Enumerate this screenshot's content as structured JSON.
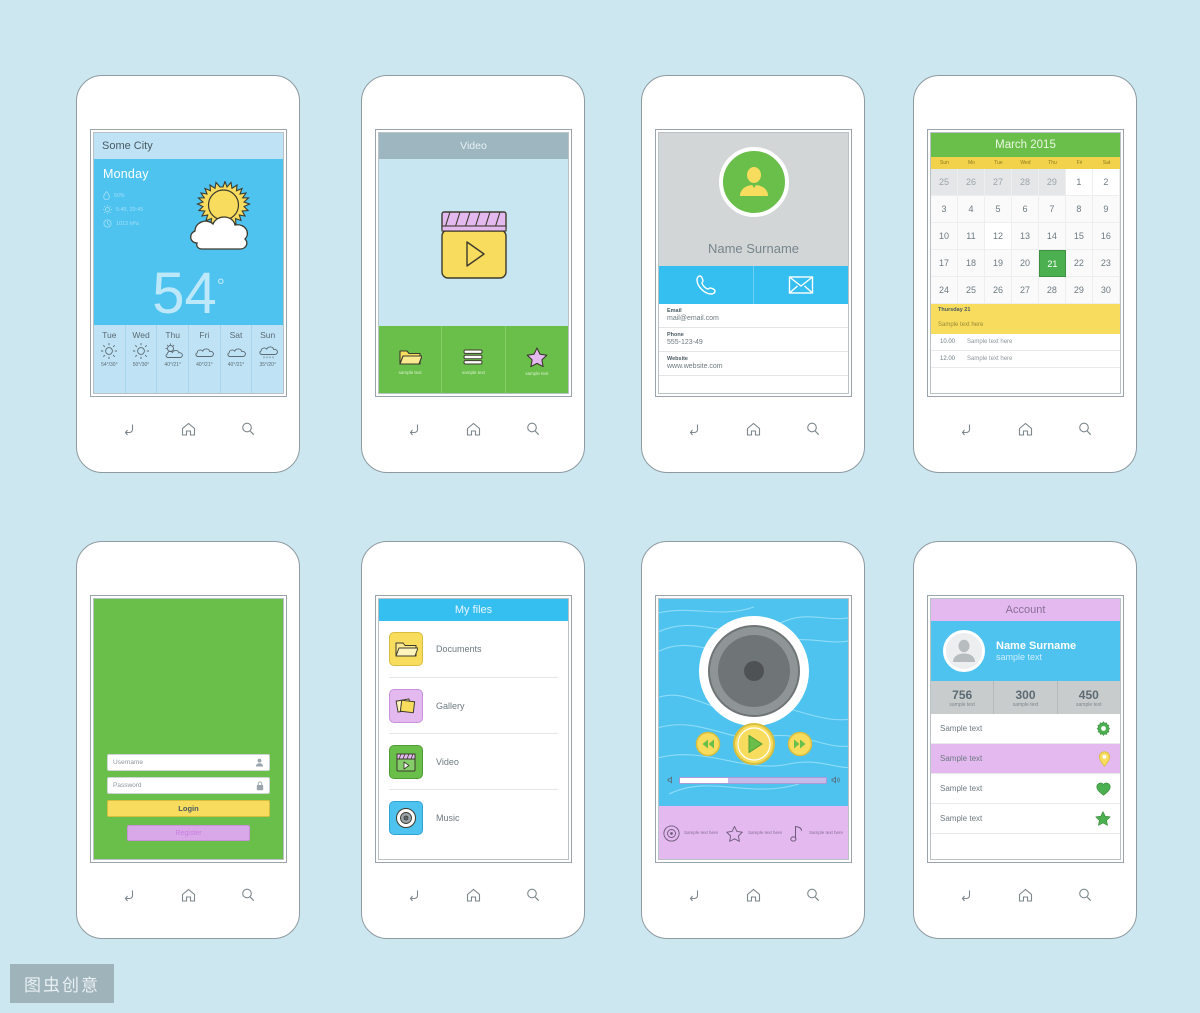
{
  "watermark": "图虫创意",
  "nav": {
    "back": "back-arrow-icon",
    "home": "home-icon",
    "search": "search-icon"
  },
  "colors": {
    "background": "#cde7f0",
    "sky_blue": "#4ec3f0",
    "green": "#6abf4b",
    "yellow": "#f7dc5e",
    "purple": "#e3b9f0",
    "gray": "#d3d6d7"
  },
  "phones": {
    "weather": {
      "city": "Some City",
      "day": "Monday",
      "stats": [
        {
          "icon": "humidity-drop-icon",
          "text": "50%"
        },
        {
          "icon": "sun-times-icon",
          "text": "5:40, 20:45"
        },
        {
          "icon": "wind-clock-icon",
          "text": "1013 hPa"
        }
      ],
      "temperature": "54",
      "degree": "°",
      "forecast": [
        {
          "day": "Tue",
          "icon": "sun-icon",
          "temp": "54°/30°"
        },
        {
          "day": "Wed",
          "icon": "sun-icon",
          "temp": "50°/30°"
        },
        {
          "day": "Thu",
          "icon": "sun-cloud-icon",
          "temp": "40°/21°"
        },
        {
          "day": "Fri",
          "icon": "cloud-icon",
          "temp": "40°/21°"
        },
        {
          "day": "Sat",
          "icon": "cloud-icon",
          "temp": "40°/21°"
        },
        {
          "day": "Sun",
          "icon": "rain-cloud-icon",
          "temp": "35°/20°"
        }
      ]
    },
    "video": {
      "title": "Video",
      "poster_icon": "clapperboard-play-icon",
      "tabs": [
        {
          "icon": "folder-icon",
          "label": "sample text"
        },
        {
          "icon": "list-icon",
          "label": "sample text"
        },
        {
          "icon": "star-icon",
          "label": "sample text"
        }
      ]
    },
    "contact": {
      "avatar_icon": "person-avatar-icon",
      "name": "Name Surname",
      "actions": [
        {
          "icon": "phone-icon",
          "label": "call"
        },
        {
          "icon": "envelope-icon",
          "label": "email"
        }
      ],
      "fields": [
        {
          "label": "Email",
          "value": "mail@email.com"
        },
        {
          "label": "Phone",
          "value": "555-123-49"
        },
        {
          "label": "Website",
          "value": "www.website.com"
        }
      ]
    },
    "calendar": {
      "title": "March 2015",
      "weekdays": [
        "Sun",
        "Mo",
        "Tue",
        "Wed",
        "Thu",
        "Fri",
        "Sat"
      ],
      "days": [
        {
          "n": "25",
          "type": "other"
        },
        {
          "n": "26",
          "type": "other"
        },
        {
          "n": "27",
          "type": "other"
        },
        {
          "n": "28",
          "type": "other"
        },
        {
          "n": "29",
          "type": "other"
        },
        {
          "n": "1",
          "type": "white"
        },
        {
          "n": "2",
          "type": "white"
        },
        {
          "n": "3",
          "type": ""
        },
        {
          "n": "4",
          "type": ""
        },
        {
          "n": "5",
          "type": ""
        },
        {
          "n": "6",
          "type": ""
        },
        {
          "n": "7",
          "type": ""
        },
        {
          "n": "8",
          "type": ""
        },
        {
          "n": "9",
          "type": ""
        },
        {
          "n": "10",
          "type": ""
        },
        {
          "n": "11",
          "type": ""
        },
        {
          "n": "12",
          "type": "white"
        },
        {
          "n": "13",
          "type": ""
        },
        {
          "n": "14",
          "type": ""
        },
        {
          "n": "15",
          "type": ""
        },
        {
          "n": "16",
          "type": ""
        },
        {
          "n": "17",
          "type": ""
        },
        {
          "n": "18",
          "type": ""
        },
        {
          "n": "19",
          "type": ""
        },
        {
          "n": "20",
          "type": ""
        },
        {
          "n": "21",
          "type": "sel"
        },
        {
          "n": "22",
          "type": ""
        },
        {
          "n": "23",
          "type": ""
        },
        {
          "n": "24",
          "type": ""
        },
        {
          "n": "25",
          "type": ""
        },
        {
          "n": "26",
          "type": ""
        },
        {
          "n": "27",
          "type": ""
        },
        {
          "n": "28",
          "type": ""
        },
        {
          "n": "29",
          "type": ""
        },
        {
          "n": "30",
          "type": ""
        }
      ],
      "event_header": {
        "title": "Thursday 21",
        "text": "Sample text here"
      },
      "events": [
        {
          "time": "10.00",
          "text": "Sample text here"
        },
        {
          "time": "12.00",
          "text": "Sample text here"
        }
      ]
    },
    "login": {
      "username_placeholder": "Username",
      "username_icon": "person-icon",
      "password_placeholder": "Password",
      "password_icon": "lock-icon",
      "login_label": "Login",
      "register_label": "Register"
    },
    "myfiles": {
      "title": "My files",
      "items": [
        {
          "label": "Documents",
          "icon": "folder-icon",
          "color": "#f7dc5e"
        },
        {
          "label": "Gallery",
          "icon": "photos-icon",
          "color": "#e3b9f0"
        },
        {
          "label": "Video",
          "icon": "clapperboard-icon",
          "color": "#6abf4b"
        },
        {
          "label": "Music",
          "icon": "disc-icon",
          "color": "#4ec3f0"
        }
      ]
    },
    "music": {
      "disc_icon": "vinyl-disc-icon",
      "controls": [
        {
          "icon": "rewind-icon"
        },
        {
          "icon": "play-icon"
        },
        {
          "icon": "fast-forward-icon"
        }
      ],
      "volume_min_icon": "volume-low-icon",
      "volume_max_icon": "volume-high-icon",
      "volume_percent": 33,
      "tabs": [
        {
          "icon": "disc-icon",
          "label": "Sample text here"
        },
        {
          "icon": "star-icon",
          "label": "Sample text here"
        },
        {
          "icon": "note-icon",
          "label": "Sample text here"
        }
      ]
    },
    "account": {
      "title": "Account",
      "avatar_icon": "person-avatar-icon",
      "name": "Name Surname",
      "subtitle": "sample text",
      "stats": [
        {
          "value": "756",
          "label": "sample text"
        },
        {
          "value": "300",
          "label": "sample text"
        },
        {
          "value": "450",
          "label": "sample text"
        }
      ],
      "rows": [
        {
          "label": "Sample text",
          "icon": "gear-icon",
          "highlight": false
        },
        {
          "label": "Sample text",
          "icon": "map-pin-icon",
          "highlight": true
        },
        {
          "label": "Sample text",
          "icon": "heart-icon",
          "highlight": false
        },
        {
          "label": "Sample text",
          "icon": "star-icon",
          "highlight": false
        }
      ]
    }
  }
}
